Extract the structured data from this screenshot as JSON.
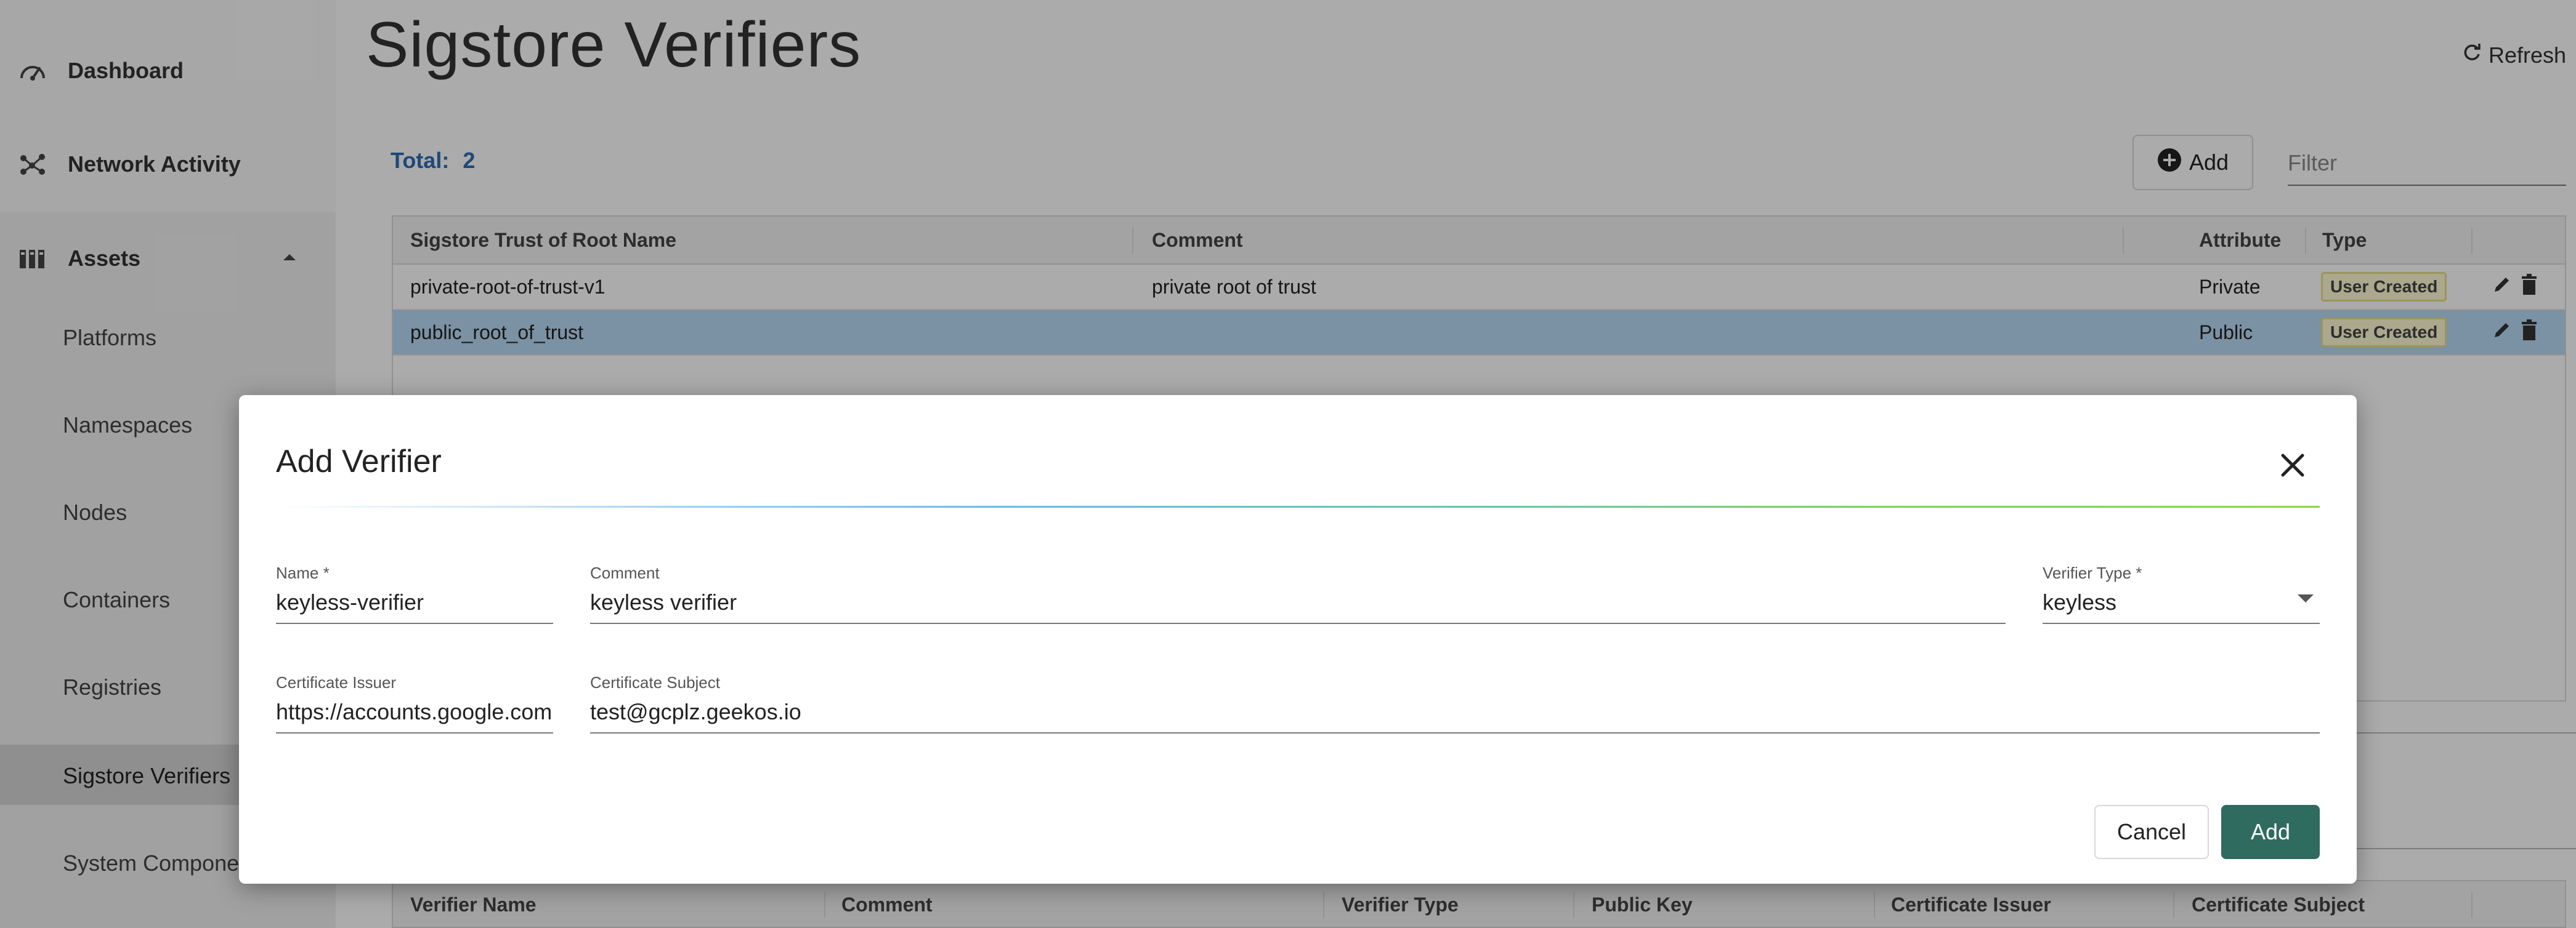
{
  "sidebar": {
    "items": [
      {
        "label": "Dashboard",
        "icon": "speedometer-icon"
      },
      {
        "label": "Network Activity",
        "icon": "network-icon"
      },
      {
        "label": "Assets",
        "icon": "assets-icon",
        "expanded": true
      }
    ],
    "assets_sub": [
      "Platforms",
      "Namespaces",
      "Nodes",
      "Containers",
      "Registries",
      "Sigstore Verifiers",
      "System Componer"
    ],
    "active_sub": "Sigstore Verifiers"
  },
  "header": {
    "title": "Sigstore Verifiers",
    "refresh_label": "Refresh"
  },
  "toolbar": {
    "total_label": "Total:",
    "total_value": "2",
    "add_label": "Add",
    "filter_placeholder": "Filter"
  },
  "roots_table": {
    "columns": [
      "Sigstore Trust of Root Name",
      "Comment",
      "Attribute",
      "Type"
    ],
    "rows": [
      {
        "name": "private-root-of-trust-v1",
        "comment": "private root of trust",
        "attribute": "Private",
        "type": "User Created",
        "selected": false
      },
      {
        "name": "public_root_of_trust",
        "comment": "",
        "attribute": "Public",
        "type": "User Created",
        "selected": true
      }
    ]
  },
  "verifiers_table": {
    "columns": [
      "Verifier Name",
      "Comment",
      "Verifier Type",
      "Public Key",
      "Certificate Issuer",
      "Certificate Subject"
    ]
  },
  "dialog": {
    "title": "Add Verifier",
    "fields": {
      "name": {
        "label": "Name *",
        "value": "keyless-verifier"
      },
      "comment": {
        "label": "Comment",
        "value": "keyless verifier"
      },
      "verifier_type": {
        "label": "Verifier Type *",
        "value": "keyless"
      },
      "cert_issuer": {
        "label": "Certificate Issuer",
        "value": "https://accounts.google.com"
      },
      "cert_subject": {
        "label": "Certificate Subject",
        "value": "test@gcplz.geekos.io"
      }
    },
    "cancel_label": "Cancel",
    "add_label": "Add"
  },
  "colors": {
    "accent_blue": "#2d6db5",
    "primary_green": "#2f6b5f",
    "selected_row": "#b8d8f5",
    "badge_bg": "#fffbd2"
  }
}
